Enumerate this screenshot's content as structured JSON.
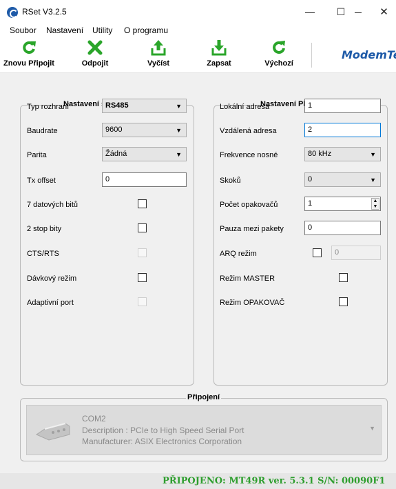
{
  "window": {
    "title": "RSet V3.2.5",
    "minimize_glyph": "—",
    "maximize_glyph": "☐",
    "close_glyph": "✕"
  },
  "menu": [
    "Soubor",
    "Nastavení",
    "Utility",
    "O programu"
  ],
  "toolbar": {
    "buttons": [
      {
        "label": "Znovu Připojit",
        "icon": "reconnect-icon",
        "color": "#2aa52a"
      },
      {
        "label": "Odpojit",
        "icon": "disconnect-icon",
        "color": "#2aa52a"
      },
      {
        "label": "Vyčíst",
        "icon": "read-icon",
        "color": "#2aa52a"
      },
      {
        "label": "Zapsat",
        "icon": "write-icon",
        "color": "#2aa52a"
      },
      {
        "label": "Výchozí",
        "icon": "default-icon",
        "color": "#2aa52a"
      }
    ],
    "logo": "ModemTec"
  },
  "serial": {
    "title": "Nastavení sériové linky",
    "interface_label": "Typ rozhraní",
    "interface_value": "RS485",
    "baudrate_label": "Baudrate",
    "baudrate_value": "9600",
    "parity_label": "Parita",
    "parity_value": "Žádná",
    "tx_offset_label": "Tx offset",
    "tx_offset_value": "0",
    "data_bits_label": "7 datových bitů",
    "data_bits_checked": false,
    "stop_bits_label": "2 stop bity",
    "stop_bits_checked": false,
    "cts_label": "CTS/RTS",
    "cts_checked": false,
    "burst_label": "Dávkový režim",
    "burst_checked": false,
    "adaptive_label": "Adaptivní port",
    "adaptive_checked": false
  },
  "plc": {
    "title": "Nastavení PLC sítě",
    "local_label": "Lokální adresa",
    "local_value": "1",
    "remote_label": "Vzdálená adresa",
    "remote_value": "2",
    "freq_label": "Frekvence nosné",
    "freq_value": "80 kHz",
    "hops_label": "Skoků",
    "hops_value": "0",
    "repeaters_label": "Počet opakovačů",
    "repeaters_value": "1",
    "pause_label": "Pauza mezi pakety",
    "pause_value": "0",
    "arq_label": "ARQ režim",
    "arq_checked": false,
    "arq_value": "0",
    "master_label": "Režim MASTER",
    "master_checked": false,
    "repeater_mode_label": "Režim OPAKOVAČ",
    "repeater_mode_checked": false
  },
  "connection": {
    "title": "Připojení",
    "port": "COM2",
    "description": "Description : PCIe to High Speed Serial Port",
    "manufacturer": "Manufacturer: ASIX Electronics Corporation"
  },
  "status": {
    "text": "PŘIPOJENO: MT49R ver. 5.3.1 S/N: 00090F1",
    "color": "#2e9e2e"
  }
}
